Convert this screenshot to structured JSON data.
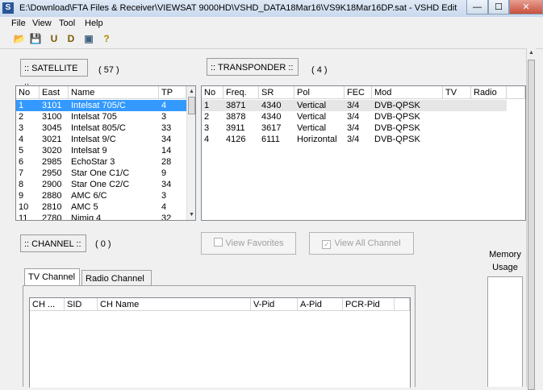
{
  "window": {
    "title": "E:\\Download\\FTA Files & Receiver\\VIEWSAT 9000HD\\VSHD_DATA18Mar16\\VS9K18Mar16DP.sat - VSHD Edit",
    "icon": "app-icon",
    "minimize": "—",
    "maximize": "☐",
    "close": "✕"
  },
  "menu": [
    "File",
    "View",
    "Tool",
    "Help"
  ],
  "toolbar": {
    "open_icon": "📂",
    "save_icon": "💾",
    "u_label": "U",
    "d_label": "D",
    "image_icon": "▣",
    "help_icon": "?"
  },
  "satellite": {
    "label": ":: SATELLITE ::",
    "count": "( 57 )",
    "headers": [
      "No",
      "East",
      "Name",
      "TP"
    ],
    "rows": [
      [
        "1",
        "3101",
        "Intelsat 705/C",
        "4"
      ],
      [
        "2",
        "3100",
        "Intelsat 705",
        "3"
      ],
      [
        "3",
        "3045",
        "Intelsat 805/C",
        "33"
      ],
      [
        "4",
        "3021",
        "Intelsat 9/C",
        "34"
      ],
      [
        "5",
        "3020",
        "Intelsat 9",
        "14"
      ],
      [
        "6",
        "2985",
        "EchoStar 3",
        "28"
      ],
      [
        "7",
        "2950",
        "Star One C1/C",
        "9"
      ],
      [
        "8",
        "2900",
        "Star One C2/C",
        "34"
      ],
      [
        "9",
        "2880",
        "AMC 6/C",
        "3"
      ],
      [
        "10",
        "2810",
        "AMC 5",
        "4"
      ],
      [
        "11",
        "2780",
        "Nimiq 4",
        "32"
      ]
    ]
  },
  "transponder": {
    "label": ":: TRANSPONDER ::",
    "count": "( 4 )",
    "headers": [
      "No",
      "Freq.",
      "SR",
      "Pol",
      "FEC",
      "Mod",
      "TV",
      "Radio"
    ],
    "rows": [
      [
        "1",
        "3871",
        "4340",
        "Vertical",
        "3/4",
        "DVB-QPSK",
        "",
        ""
      ],
      [
        "2",
        "3878",
        "4340",
        "Vertical",
        "3/4",
        "DVB-QPSK",
        "",
        ""
      ],
      [
        "3",
        "3911",
        "3617",
        "Vertical",
        "3/4",
        "DVB-QPSK",
        "",
        ""
      ],
      [
        "4",
        "4126",
        "6111",
        "Horizontal",
        "3/4",
        "DVB-QPSK",
        "",
        ""
      ]
    ]
  },
  "channel": {
    "label": ":: CHANNEL ::",
    "count": "( 0 )",
    "view_favorites": "View Favorites",
    "view_all": "View All Channel",
    "tabs": [
      "TV Channel",
      "Radio Channel"
    ],
    "headers": [
      "CH ...",
      "SID",
      "CH Name",
      "V-Pid",
      "A-Pid",
      "PCR-Pid"
    ]
  },
  "memory": {
    "label_line1": "Memory",
    "label_line2": "Usage"
  }
}
